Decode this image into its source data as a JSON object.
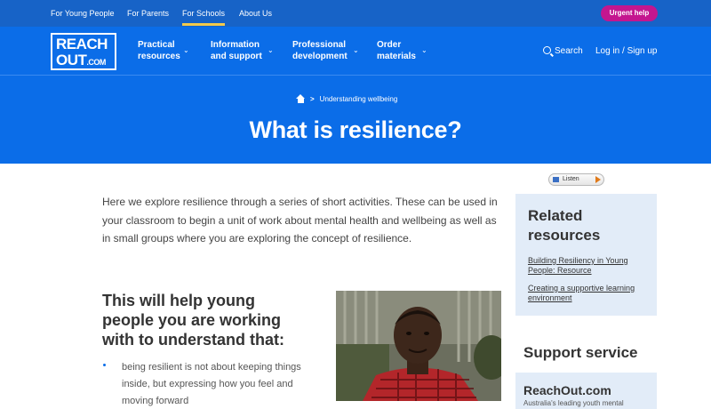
{
  "topnav": {
    "links": [
      "For Young People",
      "For Parents",
      "For Schools",
      "About Us"
    ],
    "active": "For Schools",
    "urgent_help": "Urgent help"
  },
  "logo": {
    "line1": "REACH",
    "line2": "OUT",
    "suffix": ".COM"
  },
  "mainnav": {
    "items": [
      {
        "line1": "Practical",
        "line2": "resources"
      },
      {
        "line1": "Information",
        "line2": "and support"
      },
      {
        "line1": "Professional",
        "line2": "development"
      },
      {
        "line1": "Order",
        "line2": "materials"
      }
    ],
    "search": "Search",
    "login": "Log in / Sign up"
  },
  "hero": {
    "breadcrumb": "Understanding wellbeing",
    "title": "What is resilience?"
  },
  "content": {
    "intro": "Here we explore resilience through a series of short activities. These can be used in your classroom to begin a unit of work about mental health and wellbeing as well as in small groups where you are exploring the concept of resilience.",
    "help_title": "This will help young people you are working with to understand that:",
    "bullets": [
      "being resilient is not about keeping things inside, but expressing how you feel and moving forward"
    ]
  },
  "sidebar": {
    "listen": "Listen",
    "related_title": "Related resources",
    "related_links": [
      "Building Resiliency in Young People: Resource",
      "Creating a supportive learning environment"
    ],
    "support_title": "Support service",
    "support_name": "ReachOut.com",
    "support_desc": "Australia's leading youth mental"
  },
  "colors": {
    "brand_blue": "#0b6de8",
    "top_blue": "#1763c7",
    "urgent_magenta": "#c4168f",
    "active_underline": "#f2c94c",
    "sidebar_bg": "#e2ecf8"
  }
}
